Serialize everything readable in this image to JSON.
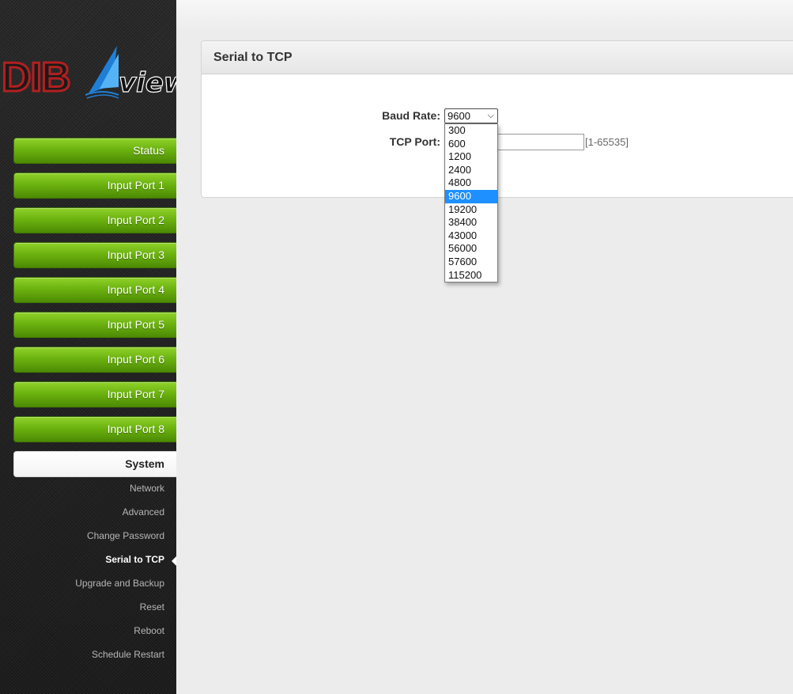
{
  "brand": {
    "logo_text_left": "DIB",
    "logo_text_right": "view",
    "colors": {
      "red": "#b31f1f",
      "blue": "#1f7fd6",
      "dark": "#1a1a1a"
    }
  },
  "sidebar": {
    "buttons": [
      {
        "label": "Status"
      },
      {
        "label": "Input Port 1"
      },
      {
        "label": "Input Port 2"
      },
      {
        "label": "Input Port 3"
      },
      {
        "label": "Input Port 4"
      },
      {
        "label": "Input Port 5"
      },
      {
        "label": "Input Port 6"
      },
      {
        "label": "Input Port 7"
      },
      {
        "label": "Input Port 8"
      },
      {
        "label": "System"
      }
    ],
    "sub_items": [
      {
        "label": "Network"
      },
      {
        "label": "Advanced"
      },
      {
        "label": "Change Password"
      },
      {
        "label": "Serial to TCP"
      },
      {
        "label": "Upgrade and Backup"
      },
      {
        "label": "Reset"
      },
      {
        "label": "Reboot"
      },
      {
        "label": "Schedule Restart"
      }
    ],
    "active_section": "System",
    "current_page": "Serial to TCP"
  },
  "panel": {
    "title": "Serial to TCP",
    "baud_label": "Baud Rate:",
    "baud_value": "9600",
    "tcp_label": "TCP Port:",
    "tcp_value": "",
    "tcp_range": "[1-65535]",
    "baud_options": [
      "300",
      "600",
      "1200",
      "2400",
      "4800",
      "9600",
      "19200",
      "38400",
      "43000",
      "56000",
      "57600",
      "115200"
    ]
  },
  "colors": {
    "nav_green": "#6cb30f",
    "selection_blue": "#1e90ff"
  }
}
